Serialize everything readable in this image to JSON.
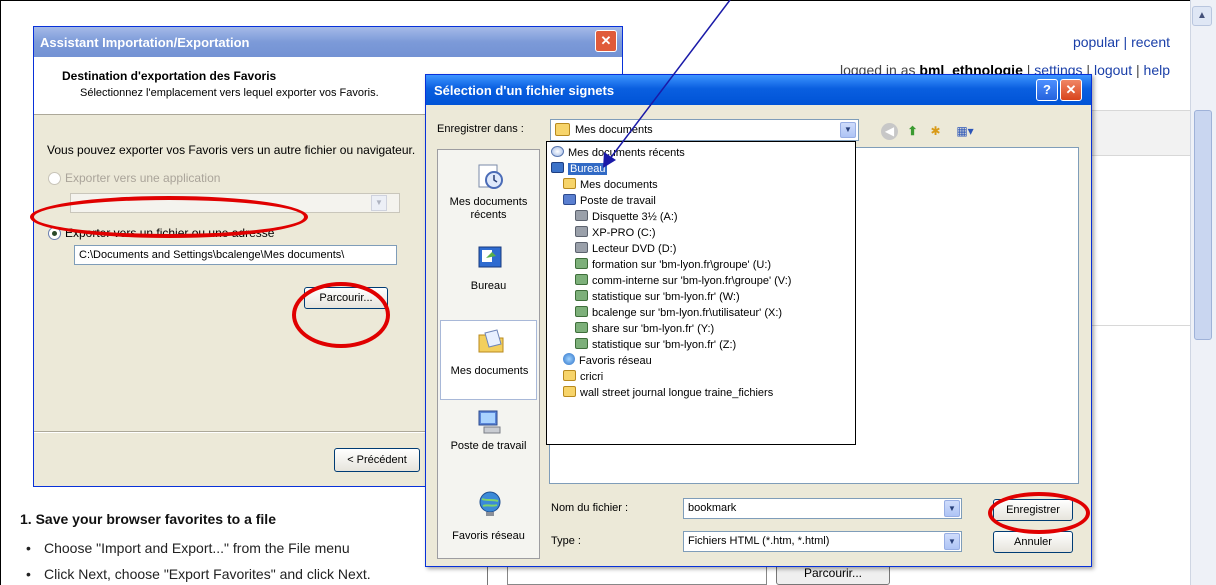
{
  "background": {
    "top_links": {
      "popular": "popular",
      "sep": "|",
      "recent": "recent"
    },
    "login": {
      "prefix": "logged in as",
      "user": "bml_ethnologie",
      "settings": "settings",
      "logout": "logout",
      "help": "help",
      "sep": "|"
    },
    "instructions": {
      "title": "1. Save your browser favorites to a file",
      "items": [
        "Choose \"Import and Export...\" from the File menu",
        "Click Next, choose \"Export Favorites\" and click Next."
      ]
    },
    "browse_button": "Parcourir..."
  },
  "wizard": {
    "title": "Assistant Importation/Exportation",
    "header_title": "Destination d'exportation des Favoris",
    "header_subtitle": "Sélectionnez l'emplacement vers lequel exporter vos Favoris.",
    "intro": "Vous pouvez exporter vos Favoris vers un autre fichier ou navigateur.",
    "option_app": "Exporter vers une application",
    "option_file": "Exporter vers un fichier ou une adresse",
    "path_value": "C:\\Documents and Settings\\bcalenge\\Mes documents\\",
    "browse_label": "Parcourir...",
    "prev_label": "< Précédent",
    "selected_option": "file"
  },
  "dialog": {
    "title": "Sélection d'un fichier signets",
    "help_icon": "?",
    "save_in_label": "Enregistrer dans :",
    "save_in_value": "Mes documents",
    "places": [
      {
        "label": "Mes documents récents",
        "icon": "recent-docs-icon"
      },
      {
        "label": "Bureau",
        "icon": "desktop-icon"
      },
      {
        "label": "Mes documents",
        "icon": "my-documents-icon"
      },
      {
        "label": "Poste de travail",
        "icon": "my-computer-icon"
      },
      {
        "label": "Favoris réseau",
        "icon": "network-places-icon"
      }
    ],
    "dropdown_items": [
      {
        "label": "Mes documents récents",
        "icon": "clock",
        "indent": 0
      },
      {
        "label": "Bureau",
        "icon": "desk",
        "indent": 0,
        "selected": true
      },
      {
        "label": "Mes documents",
        "icon": "folder",
        "indent": 1
      },
      {
        "label": "Poste de travail",
        "icon": "pc",
        "indent": 1
      },
      {
        "label": "Disquette 3½ (A:)",
        "icon": "drive",
        "indent": 2
      },
      {
        "label": "XP-PRO (C:)",
        "icon": "drive",
        "indent": 2
      },
      {
        "label": "Lecteur DVD (D:)",
        "icon": "drive",
        "indent": 2
      },
      {
        "label": "formation sur 'bm-lyon.fr\\groupe' (U:)",
        "icon": "net",
        "indent": 2
      },
      {
        "label": "comm-interne sur 'bm-lyon.fr\\groupe' (V:)",
        "icon": "net",
        "indent": 2
      },
      {
        "label": "statistique sur 'bm-lyon.fr' (W:)",
        "icon": "net",
        "indent": 2
      },
      {
        "label": "bcalenge sur 'bm-lyon.fr\\utilisateur' (X:)",
        "icon": "net",
        "indent": 2
      },
      {
        "label": "share sur 'bm-lyon.fr' (Y:)",
        "icon": "net",
        "indent": 2
      },
      {
        "label": "statistique sur 'bm-lyon.fr' (Z:)",
        "icon": "net",
        "indent": 2
      },
      {
        "label": "Favoris réseau",
        "icon": "globe",
        "indent": 1
      },
      {
        "label": "cricri",
        "icon": "folder",
        "indent": 1
      },
      {
        "label": "wall street journal longue traine_fichiers",
        "icon": "folder",
        "indent": 1
      }
    ],
    "filename_label": "Nom du fichier :",
    "filename_value": "bookmark",
    "type_label": "Type :",
    "type_value": "Fichiers HTML (*.htm, *.html)",
    "save_label": "Enregistrer",
    "cancel_label": "Annuler"
  },
  "colors": {
    "xp_title_blue": "#0a5fe0",
    "annotation_red": "#e00000",
    "annotation_arrow": "#1a1aa8",
    "selection_blue": "#316ac5"
  }
}
